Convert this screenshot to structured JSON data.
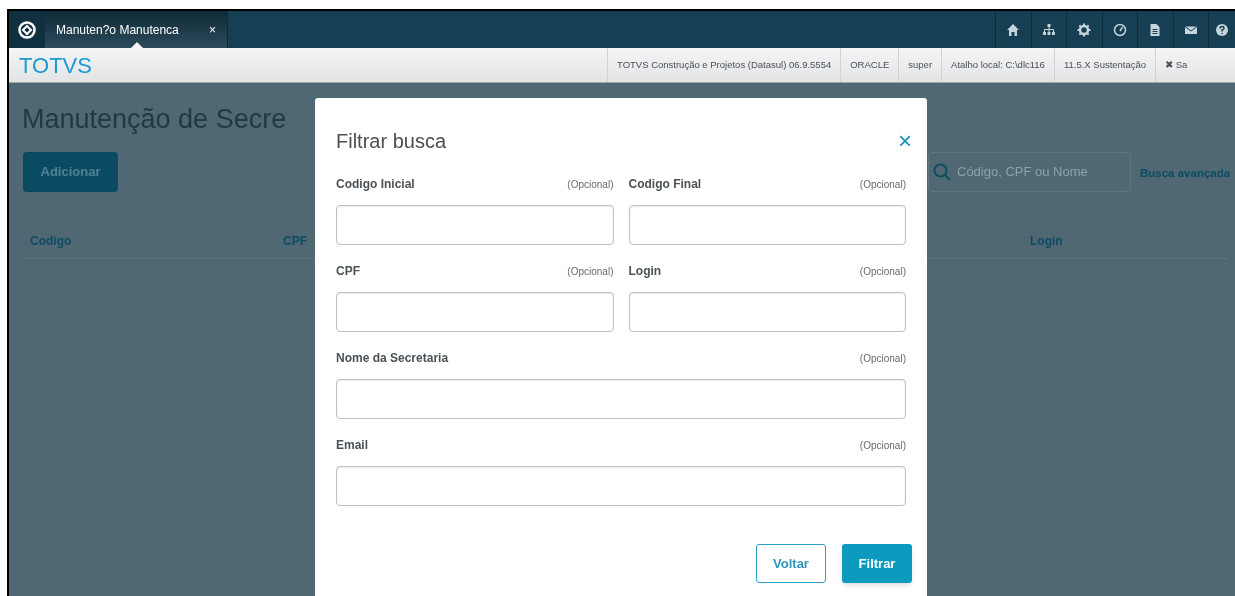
{
  "app_bar": {
    "tabs": [
      {
        "label": "Manuten?o Manutenca",
        "close": "×",
        "selected": true
      }
    ]
  },
  "info_bar": {
    "brand": "TOTVS",
    "items": [
      "TOTVS Construção e Projetos (Datasul) 06.9.5554",
      "ORACLE",
      "super",
      "Atalho local: C:\\dlc116",
      "11.5.X Sustentação",
      "✖ Sa"
    ]
  },
  "page": {
    "title": "Manutenção de Secre",
    "add_button": "Adicionar",
    "search": {
      "placeholder": "Código, CPF ou Nome"
    },
    "advanced_search": "Busca avançada",
    "columns": [
      "Codigo",
      "CPF",
      "Login"
    ]
  },
  "dialog": {
    "title": "Filtrar busca",
    "close": "×",
    "fields": [
      {
        "label": "Codigo Inicial",
        "hint": "(Opcional)",
        "kind": "half"
      },
      {
        "label": "Codigo Final",
        "hint": "(Opcional)",
        "kind": "half"
      },
      {
        "label": "CPF",
        "hint": "(Opcional)",
        "kind": "half"
      },
      {
        "label": "Login",
        "hint": "(Opcional)",
        "kind": "half"
      },
      {
        "label": "Nome da Secretaria",
        "hint": "(Opcional)",
        "kind": "full"
      },
      {
        "label": "Email",
        "hint": "(Opcional)",
        "kind": "full"
      }
    ],
    "buttons": [
      {
        "label": "Voltar",
        "kind": "secondary"
      },
      {
        "label": "Filtrar",
        "kind": "primary"
      }
    ]
  }
}
